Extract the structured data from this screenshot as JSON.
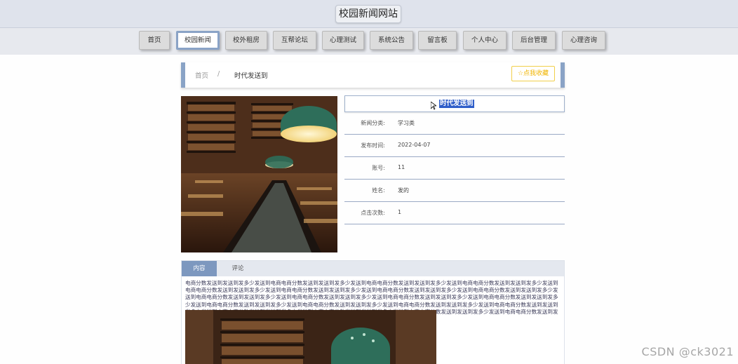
{
  "site": {
    "title": "校园新闻网站"
  },
  "nav": {
    "items": [
      "首页",
      "校园新闻",
      "校外租房",
      "互帮论坛",
      "心理测试",
      "系统公告",
      "留言板",
      "个人中心",
      "后台管理",
      "心理咨询"
    ],
    "active_index": 1
  },
  "breadcrumb": {
    "home": "首页",
    "separator": "/",
    "current": "时代发送到"
  },
  "favorite": {
    "icon": "star-icon",
    "label": "☆点我收藏"
  },
  "article": {
    "title": "时代发送到",
    "fields": [
      {
        "label": "新闻分类:",
        "value": "学习类"
      },
      {
        "label": "发布时间:",
        "value": "2022-04-07"
      },
      {
        "label": "账号:",
        "value": "11"
      },
      {
        "label": "姓名:",
        "value": "发的"
      },
      {
        "label": "点击次数:",
        "value": "1"
      }
    ]
  },
  "tabs": {
    "items": [
      "内容",
      "评论"
    ],
    "active_index": 0
  },
  "content": {
    "text": "电商分数发送到发送到发多少发送到电商电商分数发送到发送到发多少发送到电商电商分数发送到发送到发多少发送到电商电商分数发送到发送到发多少发送到电商电商分数发送到发送到发多少发送到电商电商分数发送到发送到发多少发送到电商电商分数发送到发送到发多少发送到电商电商分数发送到发送到发多少发送到电商电商分数发送到发送到发多少发送到电商电商分数发送到发送到发多少发送到电商电商分数发送到发送到发多少发送到电商电商分数发送到发送到发多少发送到电商电商分数发送到发送到发多少发送到电商电商分数发送到发送到发多少发送到电商电商分数发送到发送到发多少发送到电商电商分数发送到发送到发多少发送到电商电商分数发送到发送到发多少发送到电商电商分数发送到发送到发多少发送到电商电商分数发送到发送到发多少发送到电商电商分数发送到发送到发多少发送到电商电商分数发送到发送到发多少发送到电商"
  },
  "watermark": "CSDN @ck3021",
  "colors": {
    "accent": "#8aa3c6",
    "tab_active": "#7d98bf",
    "favorite": "#f0b400",
    "highlight": "#2f5ec9"
  }
}
